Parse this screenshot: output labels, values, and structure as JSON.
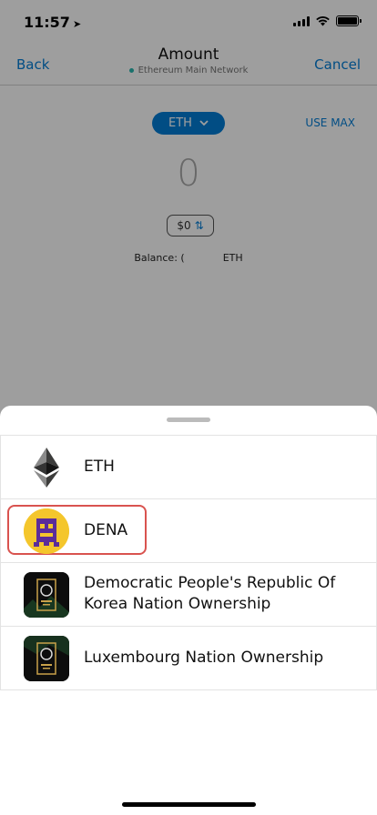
{
  "status_bar": {
    "time": "11:57",
    "location_icon": "location-arrow-icon",
    "signal_icon": "cellular-signal-icon",
    "wifi_icon": "wifi-icon",
    "battery_icon": "battery-icon"
  },
  "nav": {
    "back_label": "Back",
    "title": "Amount",
    "network": "Ethereum Main Network",
    "network_color": "#29b6af",
    "cancel_label": "Cancel"
  },
  "amount_screen": {
    "token_selector_label": "ETH",
    "use_max_label": "USE MAX",
    "amount_value": "0",
    "fiat_value": "$0",
    "balance_label": "Balance: (",
    "balance_unit": "ETH",
    "accent_color": "#037dd6"
  },
  "token_sheet": {
    "tokens": [
      {
        "name": "ETH",
        "icon": "ethereum-logo-icon",
        "highlighted": false
      },
      {
        "name": "DENA",
        "icon": "dena-token-icon",
        "highlighted": true
      },
      {
        "name": "Democratic People's Republic Of Korea Nation Ownership",
        "line1": "Democratic People's Republic Of",
        "line2": "Korea Nation Ownership",
        "icon": "nation-ownership-nft-icon",
        "highlighted": false
      },
      {
        "name": "Luxembourg Nation Ownership",
        "icon": "nation-ownership-nft-icon",
        "highlighted": false
      }
    ],
    "highlight_color": "#d9534f"
  }
}
